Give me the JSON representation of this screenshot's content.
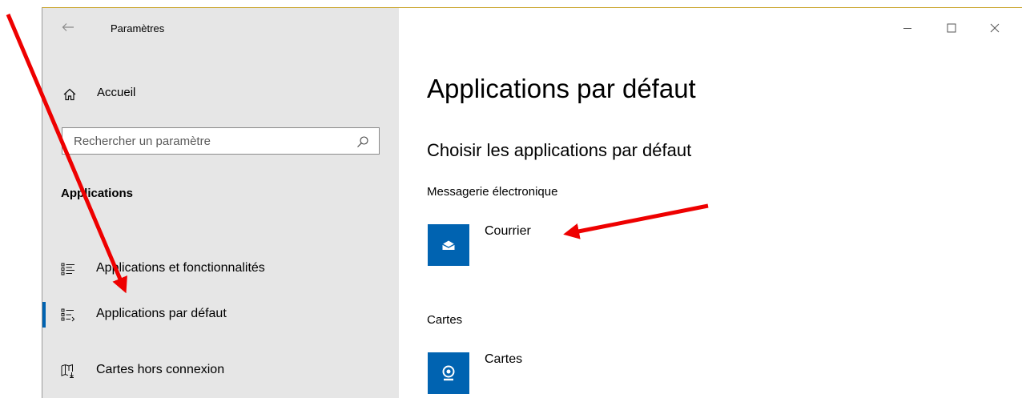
{
  "window": {
    "title": "Paramètres",
    "controls": {
      "minimize_icon": "minimize-icon",
      "maximize_icon": "maximize-icon",
      "close_icon": "close-icon"
    }
  },
  "sidebar": {
    "home_label": "Accueil",
    "search_placeholder": "Rechercher un paramètre",
    "section_title": "Applications",
    "items": [
      {
        "label": "Applications et fonctionnalités",
        "icon": "apps-features-icon",
        "active": false
      },
      {
        "label": "Applications par défaut",
        "icon": "default-apps-icon",
        "active": true
      },
      {
        "label": "Cartes hors connexion",
        "icon": "offline-maps-icon",
        "active": false
      }
    ]
  },
  "main": {
    "title": "Applications par défaut",
    "subtitle": "Choisir les applications par défaut",
    "categories": [
      {
        "label": "Messagerie électronique",
        "app": "Courrier",
        "icon": "mail-icon"
      },
      {
        "label": "Cartes",
        "app": "Cartes",
        "icon": "maps-pin-icon"
      }
    ]
  },
  "colors": {
    "accent": "#0063b1",
    "sidebar_bg": "#e6e6e6",
    "annotation_arrow": "#ee0000"
  }
}
